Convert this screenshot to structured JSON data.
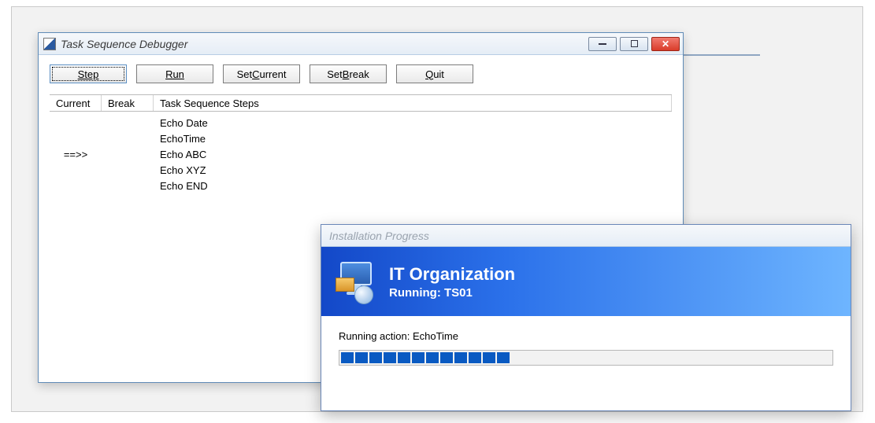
{
  "debugger": {
    "title": "Task Sequence Debugger",
    "buttons": {
      "step": "Step",
      "run": "Run",
      "set_current_pre": "Set ",
      "set_current_u": "C",
      "set_current_post": "urrent",
      "set_break_pre": "Set ",
      "set_break_u": "B",
      "set_break_post": "reak",
      "quit_u": "Q",
      "quit_post": "uit"
    },
    "columns": {
      "current": "Current",
      "break": "Break",
      "steps": "Task Sequence Steps"
    },
    "rows": [
      {
        "current": "",
        "break": "",
        "step": "Echo Date"
      },
      {
        "current": "",
        "break": "",
        "step": "EchoTime"
      },
      {
        "current": "==>>",
        "break": "",
        "step": "Echo ABC"
      },
      {
        "current": "",
        "break": "",
        "step": "Echo XYZ"
      },
      {
        "current": "",
        "break": "",
        "step": "Echo END"
      }
    ]
  },
  "progress": {
    "title": "Installation Progress",
    "org": "IT Organization",
    "running": "Running: TS01",
    "action": "Running action: EchoTime",
    "segments_filled": 12
  }
}
